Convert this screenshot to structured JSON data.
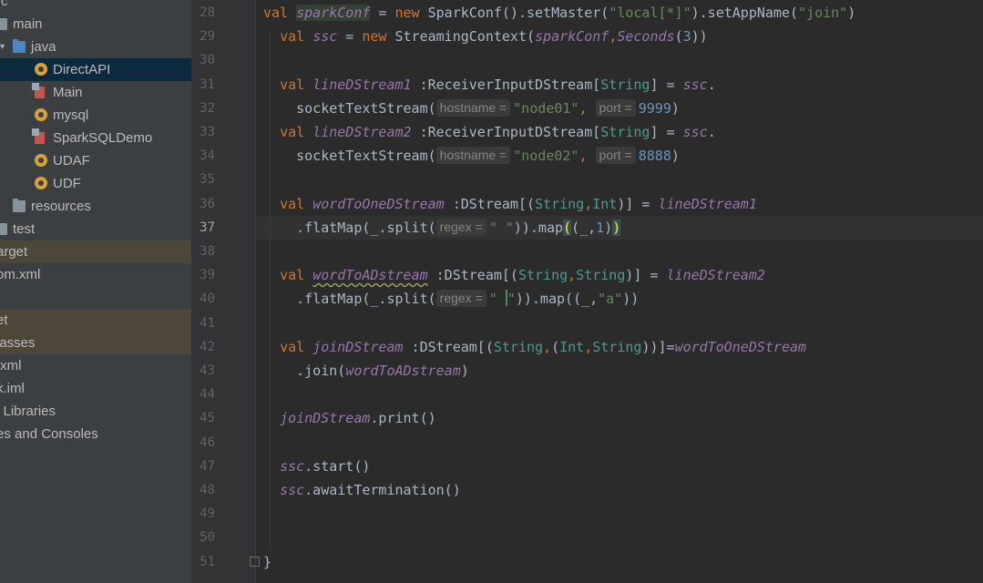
{
  "project_tree": {
    "items": [
      {
        "label": "rc",
        "kind": "folder"
      },
      {
        "label": "main",
        "kind": "folder"
      },
      {
        "label": "java",
        "kind": "folder-source"
      },
      {
        "label": "DirectAPI",
        "kind": "class",
        "selected": true
      },
      {
        "label": "Main",
        "kind": "scala-object"
      },
      {
        "label": "mysql",
        "kind": "class"
      },
      {
        "label": "SparkSQLDemo",
        "kind": "scala-object"
      },
      {
        "label": "UDAF",
        "kind": "class"
      },
      {
        "label": "UDF",
        "kind": "class"
      },
      {
        "label": "resources",
        "kind": "folder-resources"
      },
      {
        "label": "test",
        "kind": "folder"
      },
      {
        "label": "arget",
        "kind": "folder-excluded",
        "highlighted": true
      },
      {
        "label": "om.xml",
        "kind": "file"
      },
      {
        "label": "",
        "kind": "blank"
      },
      {
        "label": "et",
        "kind": "folder-excluded",
        "highlighted": true
      },
      {
        "label": "lasses",
        "kind": "folder-excluded",
        "highlighted": true
      },
      {
        "label": ".xml",
        "kind": "file"
      },
      {
        "label": "k.iml",
        "kind": "file"
      },
      {
        "label": "l Libraries",
        "kind": "libraries"
      },
      {
        "label": "es and Consoles",
        "kind": "scratches"
      }
    ],
    "icons": {
      "folder": "folder-icon",
      "folder-source": "source-folder-icon",
      "class": "class-icon",
      "scala-object": "scala-object-icon",
      "folder-resources": "resources-folder-icon"
    }
  },
  "editor": {
    "current_line": "37",
    "lines": [
      {
        "no": "28",
        "tokens": [
          [
            "k",
            "val "
          ],
          [
            "v hlvar",
            "sparkConf"
          ],
          [
            "m",
            " = "
          ],
          [
            "k",
            "new "
          ],
          [
            "m",
            "SparkConf().setMaster("
          ],
          [
            "s",
            "\"local[*]\""
          ],
          [
            "m",
            ").setAppName("
          ],
          [
            "s",
            "\"join\""
          ],
          [
            "m",
            ")"
          ]
        ]
      },
      {
        "no": "29",
        "tokens": [
          [
            "m",
            "  "
          ],
          [
            "k",
            "val "
          ],
          [
            "v",
            "ssc"
          ],
          [
            "m",
            " = "
          ],
          [
            "k",
            "new "
          ],
          [
            "m",
            "StreamingContext("
          ],
          [
            "v",
            "sparkConf"
          ],
          [
            "k",
            ","
          ],
          [
            "v",
            "Seconds"
          ],
          [
            "m",
            "("
          ],
          [
            "n",
            "3"
          ],
          [
            "m",
            "))"
          ]
        ]
      },
      {
        "no": "30",
        "tokens": []
      },
      {
        "no": "31",
        "tokens": [
          [
            "m",
            "  "
          ],
          [
            "k",
            "val "
          ],
          [
            "v",
            "lineDStream1"
          ],
          [
            "m",
            " :ReceiverInputDStream["
          ],
          [
            "t",
            "String"
          ],
          [
            "m",
            "] = "
          ],
          [
            "v",
            "ssc"
          ],
          [
            "m",
            "."
          ]
        ]
      },
      {
        "no": "32",
        "tokens": [
          [
            "m",
            "    socketTextStream("
          ],
          [
            "hint",
            "hostname ="
          ],
          [
            "s",
            "\"node01\""
          ],
          [
            "k",
            ", "
          ],
          [
            "hint",
            "port ="
          ],
          [
            "n",
            "9999"
          ],
          [
            "m",
            ")"
          ]
        ]
      },
      {
        "no": "33",
        "tokens": [
          [
            "m",
            "  "
          ],
          [
            "k",
            "val "
          ],
          [
            "v",
            "lineDStream2"
          ],
          [
            "m",
            " :ReceiverInputDStream["
          ],
          [
            "t",
            "String"
          ],
          [
            "m",
            "] = "
          ],
          [
            "v",
            "ssc"
          ],
          [
            "m",
            "."
          ]
        ]
      },
      {
        "no": "34",
        "tokens": [
          [
            "m",
            "    socketTextStream("
          ],
          [
            "hint",
            "hostname ="
          ],
          [
            "s",
            "\"node02\""
          ],
          [
            "k",
            ", "
          ],
          [
            "hint",
            "port ="
          ],
          [
            "n",
            "8888"
          ],
          [
            "m",
            ")"
          ]
        ]
      },
      {
        "no": "35",
        "tokens": []
      },
      {
        "no": "36",
        "tokens": [
          [
            "m",
            "  "
          ],
          [
            "k",
            "val "
          ],
          [
            "v",
            "wordToOneDStream"
          ],
          [
            "m",
            " :DStream[("
          ],
          [
            "t",
            "String"
          ],
          [
            "k",
            ","
          ],
          [
            "t",
            "Int"
          ],
          [
            "m",
            ")] = "
          ],
          [
            "v",
            "lineDStream1"
          ]
        ]
      },
      {
        "no": "37",
        "tokens": [
          [
            "m",
            "    .flatMap(_.split("
          ],
          [
            "hint",
            "regex ="
          ],
          [
            "s",
            "\" \""
          ],
          [
            "m",
            ")).map"
          ],
          [
            "yel",
            "("
          ],
          [
            "m",
            "(_,"
          ],
          [
            "n",
            "1"
          ],
          [
            "m",
            ")"
          ],
          [
            "yel",
            ")"
          ]
        ]
      },
      {
        "no": "38",
        "tokens": []
      },
      {
        "no": "39",
        "tokens": [
          [
            "m",
            "  "
          ],
          [
            "k",
            "val "
          ],
          [
            "v warn",
            "wordToADstream"
          ],
          [
            "m",
            " :DStream[("
          ],
          [
            "t",
            "String"
          ],
          [
            "k",
            ","
          ],
          [
            "t",
            "String"
          ],
          [
            "m",
            ")] = "
          ],
          [
            "v",
            "lineDStream2"
          ]
        ]
      },
      {
        "no": "40",
        "tokens": [
          [
            "m",
            "    .flatMap(_.split("
          ],
          [
            "hint",
            "regex ="
          ],
          [
            "s",
            "\" "
          ],
          [
            "caret",
            ""
          ],
          [
            "s",
            "\""
          ],
          [
            "m",
            ")).map((_,"
          ],
          [
            "s",
            "\"a\""
          ],
          [
            "m",
            "))"
          ]
        ]
      },
      {
        "no": "41",
        "tokens": []
      },
      {
        "no": "42",
        "tokens": [
          [
            "m",
            "  "
          ],
          [
            "k",
            "val "
          ],
          [
            "v",
            "joinDStream"
          ],
          [
            "m",
            " :DStream[("
          ],
          [
            "t",
            "String"
          ],
          [
            "k",
            ","
          ],
          [
            "m",
            "("
          ],
          [
            "t",
            "Int"
          ],
          [
            "k",
            ","
          ],
          [
            "t",
            "String"
          ],
          [
            "m",
            "))]="
          ],
          [
            "v",
            "wordToOneDStream"
          ]
        ]
      },
      {
        "no": "43",
        "tokens": [
          [
            "m",
            "    .join("
          ],
          [
            "v",
            "wordToADstream"
          ],
          [
            "m",
            ")"
          ]
        ]
      },
      {
        "no": "44",
        "tokens": []
      },
      {
        "no": "45",
        "tokens": [
          [
            "m",
            "  "
          ],
          [
            "v",
            "joinDStream"
          ],
          [
            "m",
            ".print()"
          ]
        ]
      },
      {
        "no": "46",
        "tokens": []
      },
      {
        "no": "47",
        "tokens": [
          [
            "m",
            "  "
          ],
          [
            "v",
            "ssc"
          ],
          [
            "m",
            ".start()"
          ]
        ]
      },
      {
        "no": "48",
        "tokens": [
          [
            "m",
            "  "
          ],
          [
            "v",
            "ssc"
          ],
          [
            "m",
            ".awaitTermination()"
          ]
        ]
      },
      {
        "no": "49",
        "tokens": []
      },
      {
        "no": "50",
        "tokens": []
      },
      {
        "no": "51",
        "tokens": [
          [
            "m",
            "}"
          ]
        ]
      }
    ]
  }
}
